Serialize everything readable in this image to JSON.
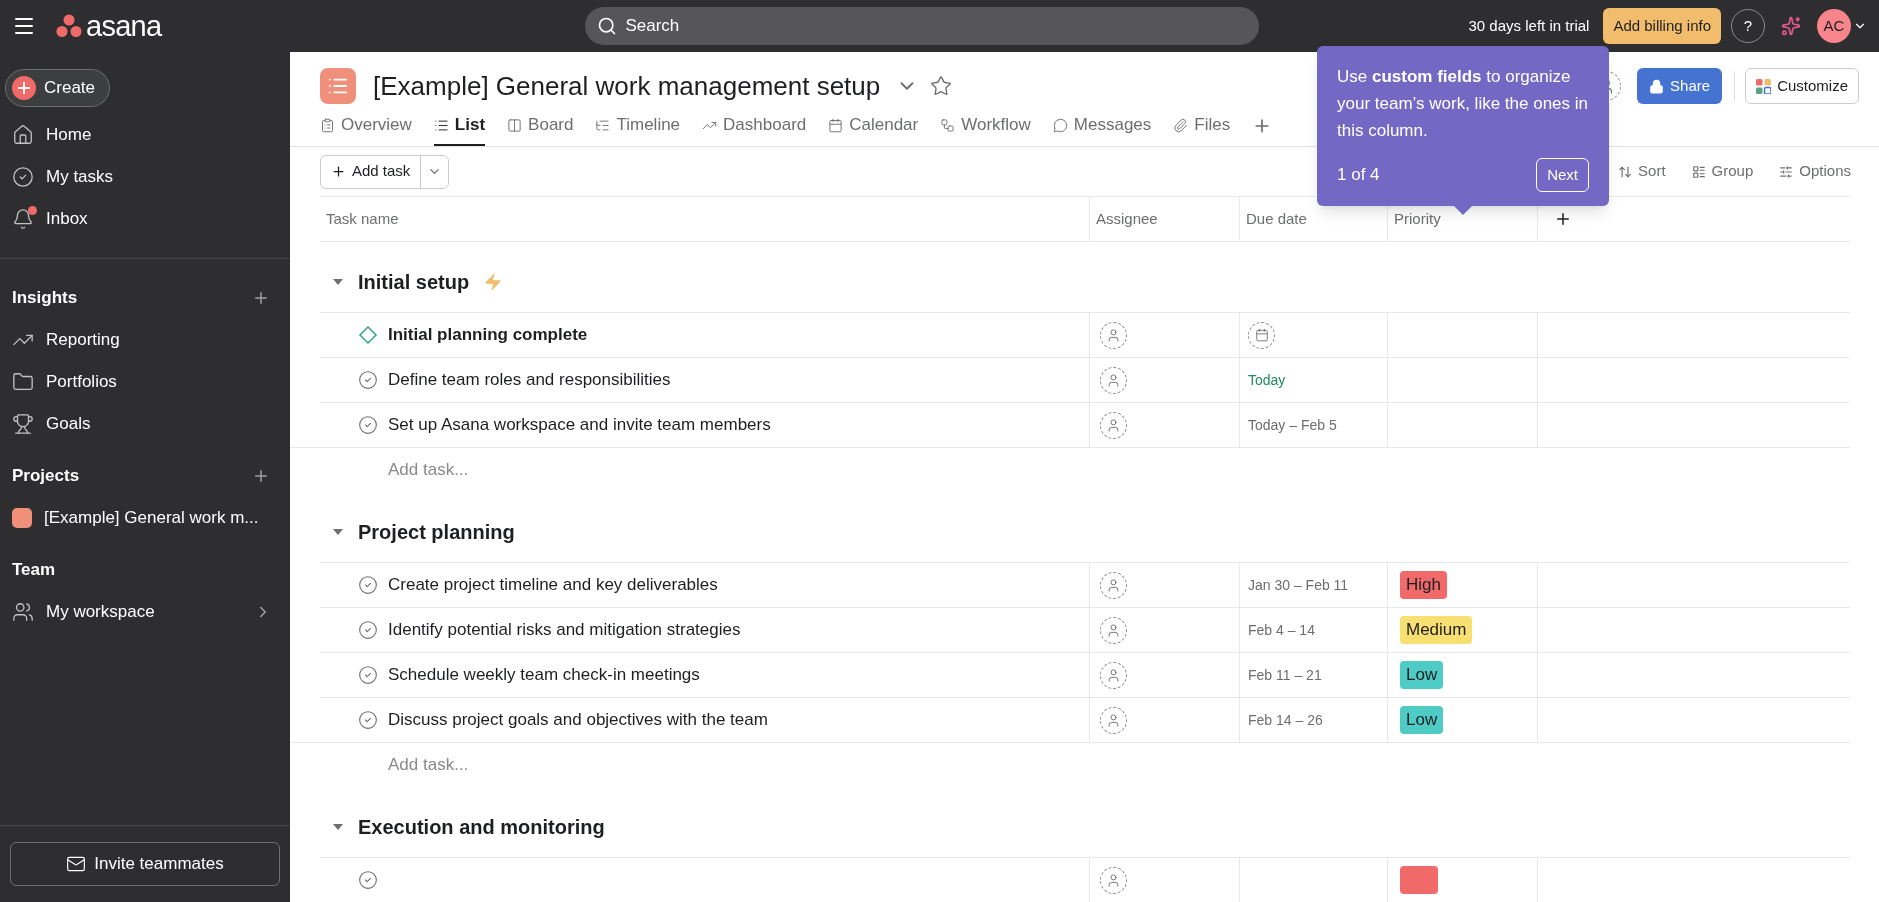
{
  "topbar": {
    "logo": "asana",
    "search": {
      "placeholder": "Search"
    },
    "trial": "30 days left in trial",
    "billing_button": "Add billing info",
    "help": "?",
    "avatar": "AC"
  },
  "sidebar": {
    "create": "Create",
    "nav": [
      {
        "label": "Home",
        "unread": false
      },
      {
        "label": "My tasks",
        "unread": false
      },
      {
        "label": "Inbox",
        "unread": true
      }
    ],
    "sections": [
      {
        "title": "Insights",
        "has_add": true,
        "items": [
          {
            "label": "Reporting"
          },
          {
            "label": "Portfolios"
          },
          {
            "label": "Goals"
          }
        ]
      },
      {
        "title": "Projects",
        "has_add": true,
        "items": [
          {
            "label": "[Example] General work m...",
            "color": "#f1907a"
          }
        ]
      },
      {
        "title": "Team",
        "has_add": false,
        "items": [
          {
            "label": "My workspace",
            "has_chevron": true
          }
        ]
      }
    ],
    "invite": "Invite teammates"
  },
  "project": {
    "title": "[Example] General work management setup",
    "share": "Share",
    "customize": "Customize",
    "tabs": [
      {
        "label": "Overview",
        "selected": false
      },
      {
        "label": "List",
        "selected": true
      },
      {
        "label": "Board",
        "selected": false
      },
      {
        "label": "Timeline",
        "selected": false
      },
      {
        "label": "Dashboard",
        "selected": false
      },
      {
        "label": "Calendar",
        "selected": false
      },
      {
        "label": "Workflow",
        "selected": false
      },
      {
        "label": "Messages",
        "selected": false
      },
      {
        "label": "Files",
        "selected": false
      }
    ],
    "toolbar": {
      "add_task": "Add task",
      "actions": [
        "Sort",
        "Group",
        "Options"
      ]
    },
    "columns": [
      "Task name",
      "Assignee",
      "Due date",
      "Priority"
    ],
    "sections": [
      {
        "title": "Initial setup",
        "expanded": true,
        "automation": true,
        "add_task": "Add task...",
        "rows": [
          {
            "kind": "milestone",
            "name": "Initial planning complete"
          },
          {
            "kind": "task",
            "name": "Define team roles and responsibilities",
            "due": "Today",
            "due_highlight": true
          },
          {
            "kind": "task",
            "name": "Set up Asana workspace and invite team members",
            "due": "Today – Feb 5",
            "due_highlight": false
          }
        ]
      },
      {
        "title": "Project planning",
        "expanded": true,
        "automation": false,
        "add_task": "Add task...",
        "rows": [
          {
            "kind": "task",
            "name": "Create project timeline and key deliverables",
            "due": "Jan 30 – Feb 11",
            "due_highlight": false,
            "priority": {
              "label": "High",
              "color": "#f06a6a"
            }
          },
          {
            "kind": "task",
            "name": "Identify potential risks and mitigation strategies",
            "due": "Feb 4 – 14",
            "due_highlight": false,
            "priority": {
              "label": "Medium",
              "color": "#f8df72"
            }
          },
          {
            "kind": "task",
            "name": "Schedule weekly team check-in meetings",
            "due": "Feb 11 – 21",
            "due_highlight": false,
            "priority": {
              "label": "Low",
              "color": "#4ecbc4"
            }
          },
          {
            "kind": "task",
            "name": "Discuss project goals and objectives with the team",
            "due": "Feb 14 – 26",
            "due_highlight": false,
            "priority": {
              "label": "Low",
              "color": "#4ecbc4"
            }
          }
        ]
      },
      {
        "title": "Execution and monitoring",
        "expanded": true,
        "automation": false,
        "rows": [
          {
            "kind": "partial",
            "priority": {
              "color": "#f06a6a"
            }
          }
        ]
      }
    ]
  },
  "tooltip": {
    "text": "Use **custom fields** to organize your team’s work, like the ones in this column.",
    "step": "1 of 4",
    "next": "Next"
  }
}
